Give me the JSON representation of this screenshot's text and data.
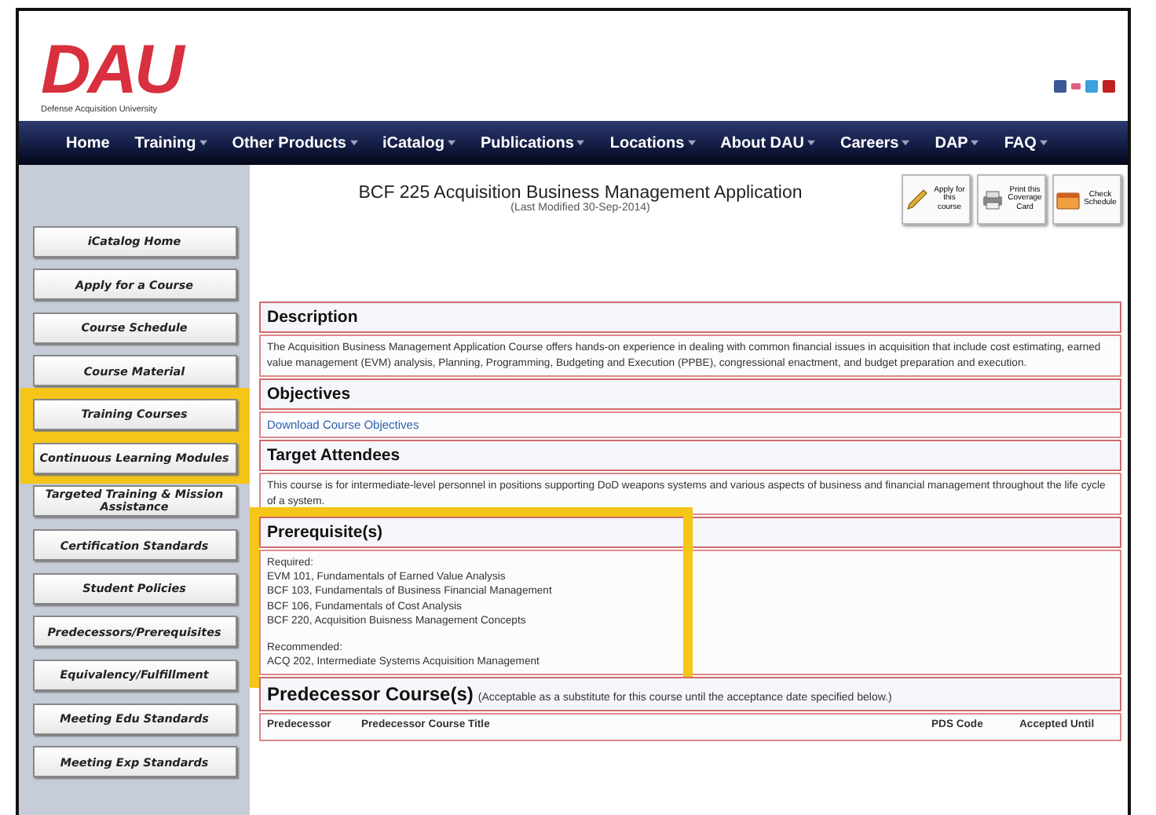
{
  "logo": {
    "mark": "DAU",
    "tagline": "Defense Acquisition University"
  },
  "nav": [
    {
      "label": "Home",
      "menu": false
    },
    {
      "label": "Training",
      "menu": true
    },
    {
      "label": "Other Products",
      "menu": true
    },
    {
      "label": "iCatalog",
      "menu": true
    },
    {
      "label": "Publications",
      "menu": true
    },
    {
      "label": "Locations",
      "menu": true
    },
    {
      "label": "About DAU",
      "menu": true
    },
    {
      "label": "Careers",
      "menu": true
    },
    {
      "label": "DAP",
      "menu": true
    },
    {
      "label": "FAQ",
      "menu": true
    }
  ],
  "sidebar": {
    "items": [
      {
        "label": "iCatalog Home",
        "highlighted": false
      },
      {
        "label": "Apply for a Course",
        "highlighted": false
      },
      {
        "label": "Course Schedule",
        "highlighted": false
      },
      {
        "label": "Course Material",
        "highlighted": false
      },
      {
        "label": "Training Courses",
        "highlighted": true
      },
      {
        "label": "Continuous Learning Modules",
        "highlighted": true
      },
      {
        "label": "Targeted Training & Mission Assistance",
        "highlighted": false
      },
      {
        "label": "Certification Standards",
        "highlighted": false
      },
      {
        "label": "Student Policies",
        "highlighted": false
      },
      {
        "label": "Predecessors/Prerequisites",
        "highlighted": false
      },
      {
        "label": "Equivalency/Fulfillment",
        "highlighted": false
      },
      {
        "label": "Meeting Edu Standards",
        "highlighted": false
      },
      {
        "label": "Meeting Exp Standards",
        "highlighted": false
      }
    ]
  },
  "course": {
    "title": "BCF 225 Acquisition Business Management Application",
    "modified": "(Last Modified 30-Sep-2014)"
  },
  "actions": [
    {
      "label": "Apply for this course",
      "kind": "pencil"
    },
    {
      "label": "Print this Coverage Card",
      "kind": "printer"
    },
    {
      "label": "Check Schedule",
      "kind": "calendar"
    }
  ],
  "sections": [
    {
      "heading": "Description",
      "kind": "text",
      "highlighted": false,
      "lines": [
        "The Acquisition Business Management Application Course offers hands-on experience in dealing with common financial issues in acquisition that include cost estimating, earned value management (EVM) analysis, Planning, Programming, Budgeting and Execution (PPBE), congressional enactment, and budget preparation and execution."
      ]
    },
    {
      "heading": "Objectives",
      "kind": "link",
      "highlighted": false,
      "lines": [
        "Download Course Objectives"
      ]
    },
    {
      "heading": "Target Attendees",
      "kind": "text",
      "highlighted": false,
      "lines": [
        "This course is for intermediate-level personnel in positions supporting DoD weapons systems and various aspects of business and financial management throughout the life cycle of a system."
      ]
    },
    {
      "heading": "Prerequisite(s)",
      "kind": "list",
      "highlighted": true,
      "groups": [
        {
          "label": "Required:",
          "items": [
            "EVM 101, Fundamentals of Earned Value Analysis",
            "BCF 103, Fundamentals of Business Financial Management",
            "BCF 106, Fundamentals of Cost Analysis",
            "BCF 220, Acquisition Buisness Management Concepts"
          ]
        },
        {
          "label": "Recommended:",
          "items": [
            "ACQ 202, Intermediate Systems Acquisition Management"
          ]
        }
      ]
    }
  ],
  "predecessor": {
    "heading": "Predecessor Course(s)",
    "note": "(Acceptable as a substitute for this course until the acceptance date specified below.)",
    "columns": [
      "Predecessor",
      "Predecessor Course Title",
      "PDS Code",
      "Accepted Until"
    ]
  }
}
